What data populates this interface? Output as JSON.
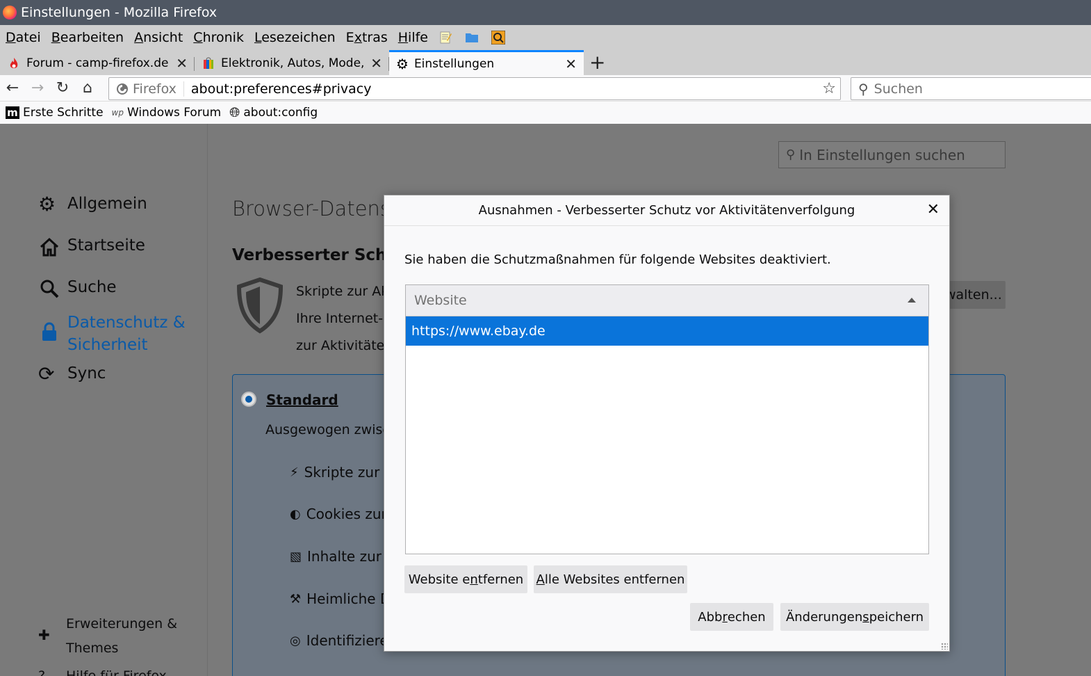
{
  "window": {
    "title": "Einstellungen - Mozilla Firefox"
  },
  "menubar": {
    "items": [
      {
        "pre": "",
        "u": "D",
        "post": "atei"
      },
      {
        "pre": "",
        "u": "B",
        "post": "earbeiten"
      },
      {
        "pre": "",
        "u": "A",
        "post": "nsicht"
      },
      {
        "pre": "",
        "u": "C",
        "post": "hronik"
      },
      {
        "pre": "",
        "u": "L",
        "post": "esezeichen"
      },
      {
        "pre": "E",
        "u": "x",
        "post": "tras"
      },
      {
        "pre": "",
        "u": "H",
        "post": "ilfe"
      }
    ]
  },
  "tabs": [
    {
      "label": "Forum - camp-firefox.de",
      "icon": "flame-icon"
    },
    {
      "label": "Elektronik, Autos, Mode, Sa",
      "icon": "ebay-bag-icon"
    },
    {
      "label": "Einstellungen",
      "icon": "gear-icon"
    }
  ],
  "navbar": {
    "identity": "Firefox",
    "url": "about:preferences#privacy",
    "search_placeholder": "Suchen"
  },
  "bookmarks": [
    {
      "label": "Erste Schritte",
      "icon": "m-logo-icon"
    },
    {
      "label": "Windows Forum",
      "icon": "wp-logo-icon"
    },
    {
      "label": "about:config",
      "icon": "globe-icon"
    }
  ],
  "sidebar": {
    "items": [
      {
        "label": "Allgemein",
        "icon": "gear-icon"
      },
      {
        "label": "Startseite",
        "icon": "home-icon"
      },
      {
        "label": "Suche",
        "icon": "search-icon"
      },
      {
        "label_line1": "Datenschutz &",
        "label_line2": "Sicherheit",
        "icon": "lock-icon"
      },
      {
        "label": "Sync",
        "icon": "sync-icon"
      }
    ],
    "extensions_line1": "Erweiterungen &",
    "extensions_line2": "Themes",
    "help": "Hilfe für Firefox"
  },
  "main": {
    "search_placeholder": "In Einstellungen suchen",
    "heading": "Browser-Datensc",
    "subheading": "Verbesserter Schutz",
    "desc_line1": "Skripte zur Ak",
    "desc_line2": "Ihre Internet-",
    "desc_line3": "zur Aktivitäter",
    "manage_button": "walten...",
    "standard_label": "Standard",
    "standard_desc": "Ausgewogen zwisc",
    "features": [
      "Skripte zur A",
      "Cookies zur",
      "Inhalte zur A",
      "Heimliche D",
      "Identifiziere"
    ]
  },
  "dialog": {
    "title": "Ausnahmen - Verbesserter Schutz vor Aktivitätenverfolgung",
    "intro": "Sie haben die Schutzmaßnahmen für folgende Websites deaktiviert.",
    "column_header": "Website",
    "rows": [
      "https://www.ebay.de"
    ],
    "remove_button": {
      "pre": "Website e",
      "u": "n",
      "post": "tfernen"
    },
    "remove_all_button": {
      "pre": "",
      "u": "A",
      "post": "lle Websites entfernen"
    },
    "cancel_button": {
      "pre": "Abb",
      "u": "r",
      "post": "echen"
    },
    "save_button": {
      "pre": "Änderungen ",
      "u": "s",
      "post": "peichern"
    }
  }
}
